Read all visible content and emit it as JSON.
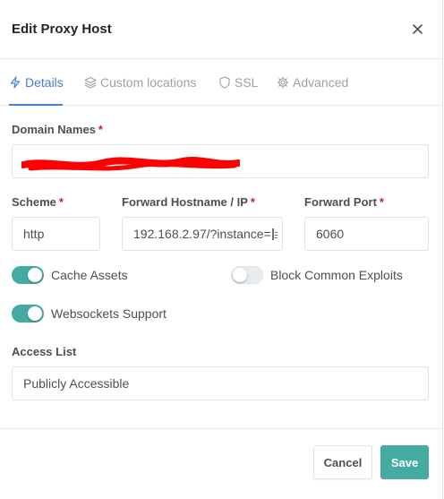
{
  "modal": {
    "title": "Edit Proxy Host",
    "close_icon": "close-icon"
  },
  "tabs": [
    {
      "label": "Details",
      "icon": "bolt-icon",
      "active": true
    },
    {
      "label": "Custom locations",
      "icon": "layers-icon",
      "active": false
    },
    {
      "label": "SSL",
      "icon": "shield-icon",
      "active": false
    },
    {
      "label": "Advanced",
      "icon": "gear-icon",
      "active": false
    }
  ],
  "form": {
    "domain_names": {
      "label": "Domain Names",
      "required_mark": "*",
      "value": ""
    },
    "scheme": {
      "label": "Scheme",
      "required_mark": "*",
      "value": "http"
    },
    "forward_hostname": {
      "label": "Forward Hostname / IP",
      "required_mark": "*",
      "value": "192.168.2.97/?instance="
    },
    "forward_port": {
      "label": "Forward Port",
      "required_mark": "*",
      "value": "6060"
    },
    "cache_assets": {
      "label": "Cache Assets",
      "enabled": true
    },
    "block_common_exploits": {
      "label": "Block Common Exploits",
      "enabled": false
    },
    "websockets_support": {
      "label": "Websockets Support",
      "enabled": true
    },
    "access_list": {
      "label": "Access List",
      "value": "Publicly Accessible"
    }
  },
  "footer": {
    "cancel_label": "Cancel",
    "save_label": "Save"
  },
  "colors": {
    "accent": "#467fcf",
    "toggle_on": "#45aaa2",
    "save_button": "#45aaa2",
    "required": "#cd201f",
    "redaction": "#ff0000"
  }
}
